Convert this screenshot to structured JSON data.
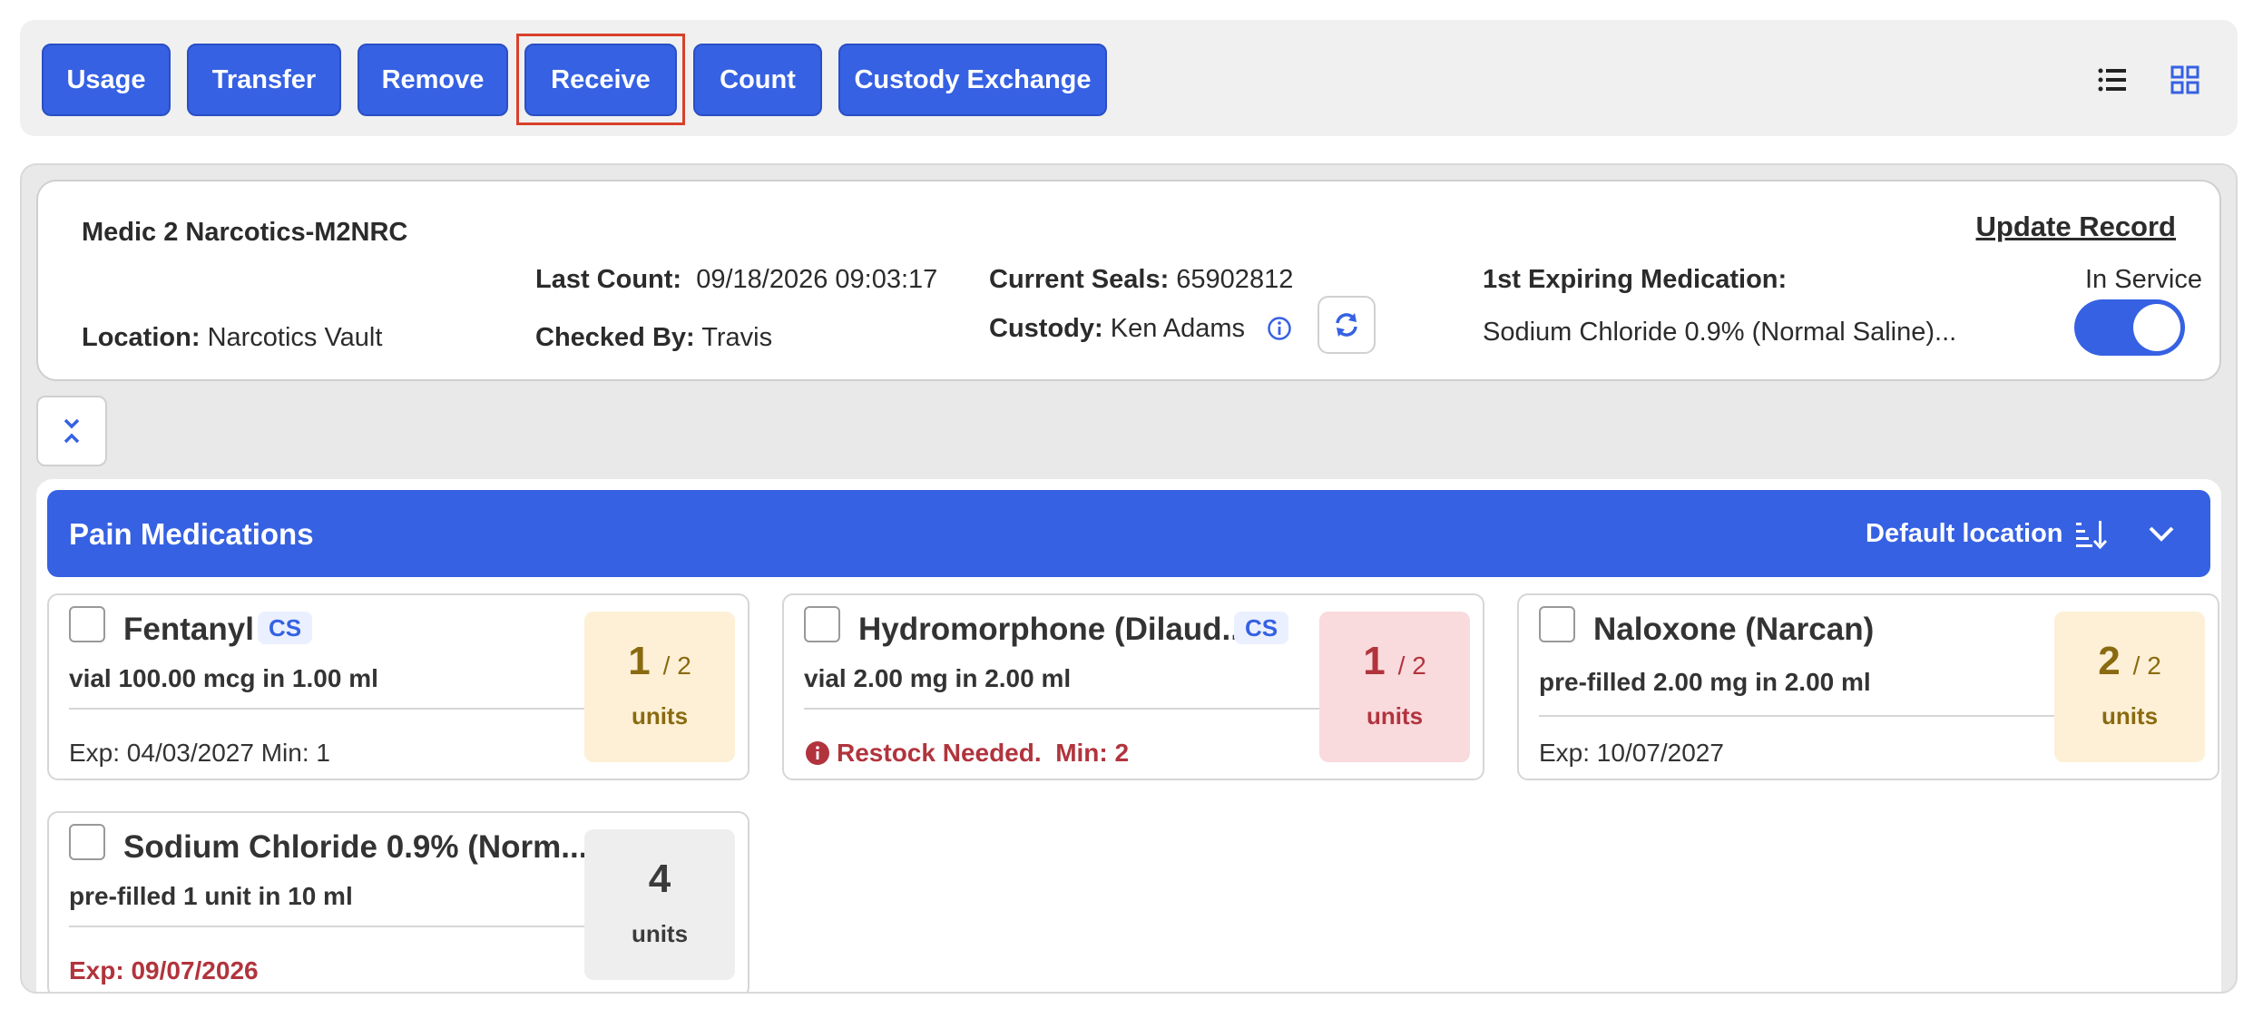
{
  "toolbar": {
    "buttons": [
      "Usage",
      "Transfer",
      "Remove",
      "Receive",
      "Count",
      "Custody Exchange"
    ],
    "highlighted": "Receive"
  },
  "record": {
    "title": "Medic 2 Narcotics-M2NRC",
    "update_link": "Update Record",
    "location_label": "Location:",
    "location_value": "Narcotics Vault",
    "last_count_label": "Last Count:",
    "last_count_value": "09/18/2026 09:03:17",
    "checked_by_label": "Checked By:",
    "checked_by_value": "Travis",
    "seals_label": "Current Seals:",
    "seals_value": "65902812",
    "custody_label": "Custody:",
    "custody_value": "Ken Adams",
    "expiring_label": "1st Expiring Medication:",
    "expiring_value": "Sodium Chloride 0.9% (Normal Saline)...",
    "service_label": "In Service",
    "in_service": true
  },
  "section": {
    "title": "Pain Medications",
    "location": "Default location"
  },
  "medications": [
    {
      "name": "Fentanyl",
      "cs": "CS",
      "desc": "vial 100.00 mcg in 1.00 ml",
      "exp": "Exp: 04/03/2027 Min: 1",
      "qty": "1",
      "of": "/ 2",
      "units": "units",
      "status": "amber"
    },
    {
      "name": "Hydromorphone (Dilaud...",
      "cs": "CS",
      "desc": "vial 2.00 mg in 2.00 ml",
      "warning": "Restock Needed.",
      "min": "Min: 2",
      "qty": "1",
      "of": "/ 2",
      "units": "units",
      "status": "red"
    },
    {
      "name": "Naloxone (Narcan)",
      "desc": "pre-filled 2.00 mg in 2.00 ml",
      "exp": "Exp: 10/07/2027",
      "qty": "2",
      "of": "/ 2",
      "units": "units",
      "status": "amber"
    },
    {
      "name": "Sodium Chloride 0.9% (Norm...",
      "desc": "pre-filled 1 unit in 10 ml",
      "exp": "Exp: 09/07/2026",
      "qty": "4",
      "units": "units",
      "status": "gray"
    }
  ],
  "colors": {
    "primary": "#3661e3",
    "warning": "#b1343d",
    "amber": "#8a6a10",
    "highlight": "#d9402b"
  }
}
